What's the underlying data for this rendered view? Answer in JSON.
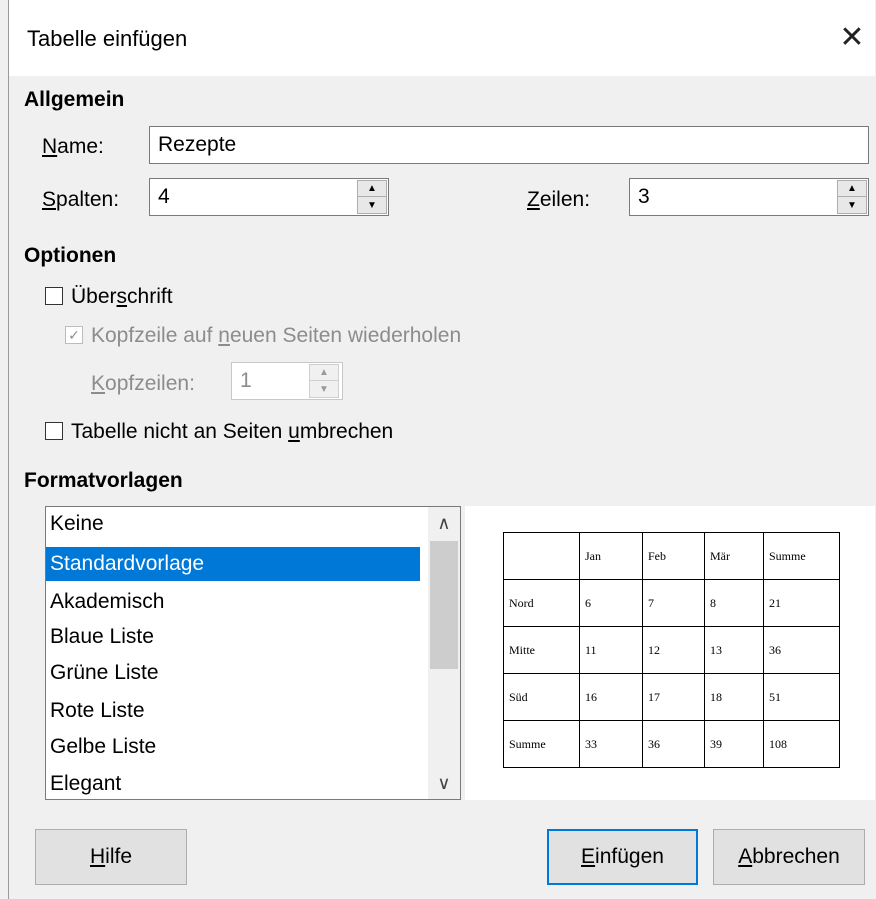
{
  "dialog": {
    "title": "Tabelle einfügen",
    "close_glyph": "✕"
  },
  "general": {
    "heading": "Allgemein",
    "name_label_u": "N",
    "name_label_rest": "ame:",
    "name_value": "Rezepte",
    "columns_label_u": "S",
    "columns_label_rest": "palten:",
    "columns_value": "4",
    "rows_label_u": "Z",
    "rows_label_rest": "eilen:",
    "rows_value": "3"
  },
  "options": {
    "heading": "Optionen",
    "heading_cb_pre": "Über",
    "heading_cb_u": "s",
    "heading_cb_post": "chrift",
    "repeat_pre": "Kopfzeile auf ",
    "repeat_u": "n",
    "repeat_post": "euen Seiten wiederholen",
    "header_rows_u": "K",
    "header_rows_rest": "opfzeilen:",
    "header_rows_value": "1",
    "nosplit_pre": "Tabelle nicht an Seiten ",
    "nosplit_u": "u",
    "nosplit_post": "mbrechen"
  },
  "styles": {
    "heading": "Formatvorlagen",
    "items": [
      "Keine",
      "Standardvorlage",
      "Akademisch",
      "Blaue Liste",
      "Grüne Liste",
      "Rote Liste",
      "Gelbe Liste",
      "Elegant"
    ],
    "selected": "Standardvorlage"
  },
  "preview_table": {
    "rows": [
      [
        "",
        "Jan",
        "Feb",
        "Mär",
        "Summe"
      ],
      [
        "Nord",
        "6",
        "7",
        "8",
        "21"
      ],
      [
        "Mitte",
        "11",
        "12",
        "13",
        "36"
      ],
      [
        "Süd",
        "16",
        "17",
        "18",
        "51"
      ],
      [
        "Summe",
        "33",
        "36",
        "39",
        "108"
      ]
    ]
  },
  "buttons": {
    "help_u": "H",
    "help_rest": "ilfe",
    "insert_u": "E",
    "insert_rest": "infügen",
    "cancel_u": "A",
    "cancel_rest": "bbrechen"
  },
  "colors": {
    "accent": "#0078d7"
  }
}
